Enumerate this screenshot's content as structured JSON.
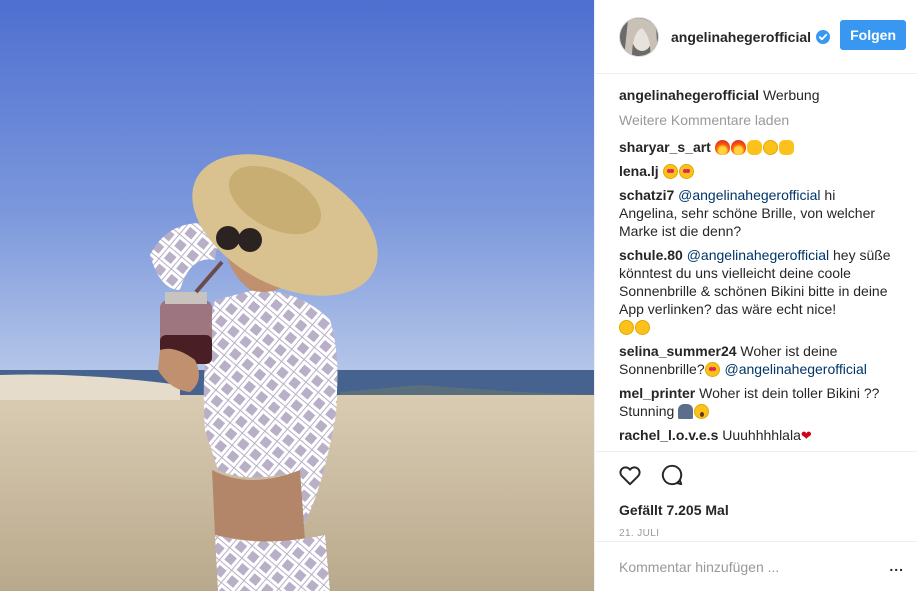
{
  "post": {
    "username": "angelinahegerofficial",
    "follow_label": "Folgen",
    "caption_user": "angelinahegerofficial",
    "caption_text": "Werbung",
    "load_more": "Weitere Kommentare laden",
    "comments": [
      {
        "user": "sharyar_s_art",
        "text": "",
        "emojis": [
          "fire",
          "fire",
          "ok-hand",
          "grin",
          "thumbs-up"
        ]
      },
      {
        "user": "lena.lj",
        "text": "",
        "emojis": [
          "heart-eyes",
          "heart-eyes"
        ]
      },
      {
        "user": "schatzi7",
        "mention": "@angelinahegerofficial",
        "text": " hi Angelina, sehr schöne Brille, von welcher Marke ist die denn?"
      },
      {
        "user": "schule.80",
        "mention": "@angelinahegerofficial",
        "text": " hey süße könntest du uns vielleicht deine coole Sonnenbrille & schönen Bikini bitte in deine App verlinken? das wäre echt nice!",
        "emojis": [
          "smile",
          "smile-blush"
        ]
      },
      {
        "user": "selina_summer24",
        "text": " Woher ist deine Sonnenbrille?",
        "mention": "@angelinahegerofficial",
        "emojis": [
          "heart-eyes"
        ]
      },
      {
        "user": "mel_printer",
        "text": " Woher ist dein toller Bikini ?? Stunning",
        "emojis": [
          "person",
          "scream"
        ]
      },
      {
        "user": "rachel_l.o.v.e.s",
        "text": " Uuuhhhhlala",
        "emojis": [
          "red-heart"
        ]
      }
    ],
    "likes": "Gefällt 7.205 Mal",
    "date": "21. JULI",
    "comment_placeholder": "Kommentar hinzufügen ...",
    "more_label": "..."
  },
  "icons": {
    "verified": "verified-badge-icon",
    "like": "heart-icon",
    "comment": "comment-bubble-icon",
    "more": "more-options-icon"
  },
  "colors": {
    "accent": "#3897f0",
    "verified": "#3897f0",
    "mention": "#003569",
    "muted": "#999999"
  }
}
